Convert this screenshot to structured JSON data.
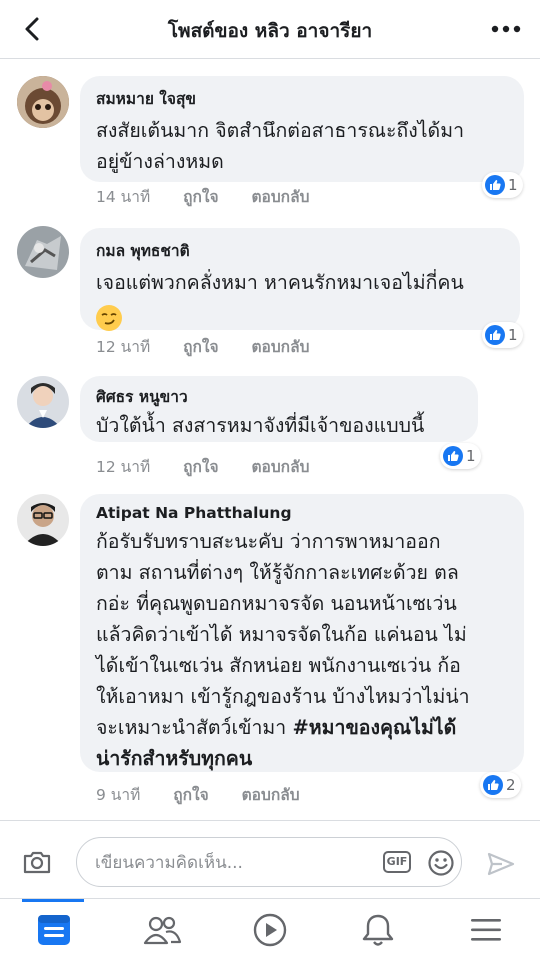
{
  "header": {
    "title": "โพสต์ของ หลิว อาจารียา"
  },
  "comments": [
    {
      "name": "สมหมาย ใจสุข",
      "lines": [
        "สงสัยเต้นมาก จิตสำนึกต่อสาธารณะถึงได้มา",
        "อยู่ข้างล่างหมด"
      ],
      "time": "14 นาที",
      "like": "ถูกใจ",
      "reply": "ตอบกลับ",
      "reactions": "1"
    },
    {
      "name": "กมล พุทธชาติ",
      "lines": [
        "เจอแต่พวกคลั่งหมา หาคนรักหมาเจอไม่กี่คน"
      ],
      "emoji": "smirk-emoji",
      "time": "12 นาที",
      "like": "ถูกใจ",
      "reply": "ตอบกลับ",
      "reactions": "1"
    },
    {
      "name": "ศิศธร หนูขาว",
      "lines": [
        "บัวใต้น้ำ สงสารหมาจังที่มีเจ้าของแบบนี้"
      ],
      "time": "12 นาที",
      "like": "ถูกใจ",
      "reply": "ตอบกลับ",
      "reactions": "1"
    },
    {
      "name": "Atipat Na Phatthalung",
      "lines": [
        "ก้อรับรับทราบสะนะคับ ว่าการพาหมาออก",
        "ตาม สถานที่ต่างๆ ให้รู้จักกาละเทศะด้วย ตล",
        "กอ่ะ ที่คุณพูดบอกหมาจรจัด นอนหน้าเซเว่น",
        "แล้วคิดว่าเข้าได้ หมาจรจัดในก้อ แค่นอน ไม่",
        "ได้เข้าในเซเว่น สักหน่อย พนักงานเซเว่น ก้อ",
        "ให้เอาหมา เข้ารู้กฎของร้าน บ้างไหมว่าไม่น่า",
        "จะเหมาะนำสัตว์เข้ามา"
      ],
      "hashtag_inline": "#หมาของคุณไม่ได้",
      "hashtag_line2": "น่ารักสำหรับทุกคน",
      "time": "9 นาที",
      "like": "ถูกใจ",
      "reply": "ตอบกลับ",
      "reactions": "2"
    }
  ],
  "composer": {
    "placeholder": "เขียนความคิดเห็น...",
    "gif_label": "GIF"
  },
  "colors": {
    "accent": "#1877f2",
    "bubble": "#f0f2f5",
    "meta": "#8a8d91"
  },
  "icons": [
    "back-arrow-icon",
    "more-icon",
    "camera-icon",
    "gif-icon",
    "smile-icon",
    "send-icon",
    "news-feed-icon",
    "friends-icon",
    "watch-icon",
    "notifications-icon",
    "menu-icon"
  ]
}
